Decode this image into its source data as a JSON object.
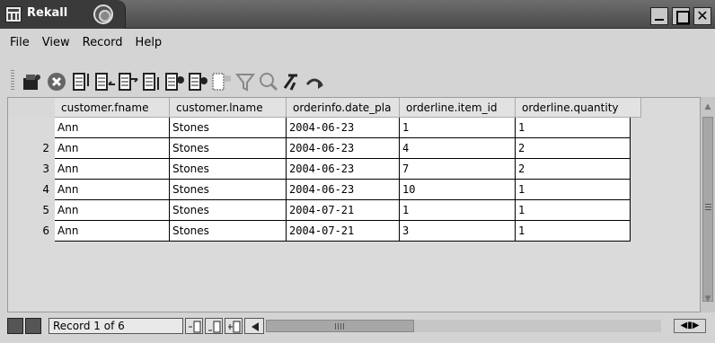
{
  "window": {
    "title": "Rekall"
  },
  "menu": [
    "File",
    "View",
    "Record",
    "Help"
  ],
  "toolbar": {
    "icons": [
      "open-icon",
      "stop-icon",
      "first-record-icon",
      "previous-record-icon",
      "next-record-icon",
      "last-record-icon",
      "insert-record-icon",
      "delete-record-icon",
      "save-record-icon",
      "filter-icon",
      "query-icon",
      "clear-query-icon",
      "redo-icon"
    ]
  },
  "grid": {
    "columns": [
      "customer.fname",
      "customer.lname",
      "orderinfo.date_pla",
      "orderline.item_id",
      "orderline.quantity"
    ],
    "rows": [
      {
        "num": "",
        "cells": [
          "Ann",
          "Stones",
          "2004-06-23",
          "1",
          "1"
        ]
      },
      {
        "num": "2",
        "cells": [
          "Ann",
          "Stones",
          "2004-06-23",
          "4",
          "2"
        ]
      },
      {
        "num": "3",
        "cells": [
          "Ann",
          "Stones",
          "2004-06-23",
          "7",
          "2"
        ]
      },
      {
        "num": "4",
        "cells": [
          "Ann",
          "Stones",
          "2004-06-23",
          "10",
          "1"
        ]
      },
      {
        "num": "5",
        "cells": [
          "Ann",
          "Stones",
          "2004-07-21",
          "1",
          "1"
        ]
      },
      {
        "num": "6",
        "cells": [
          "Ann",
          "Stones",
          "2004-07-21",
          "3",
          "1"
        ]
      }
    ]
  },
  "status": {
    "record": "Record 1 of 6"
  },
  "colors": {
    "titlebar": "#4a4a4a",
    "background": "#d4d4d4",
    "cell": "#ffffff"
  }
}
